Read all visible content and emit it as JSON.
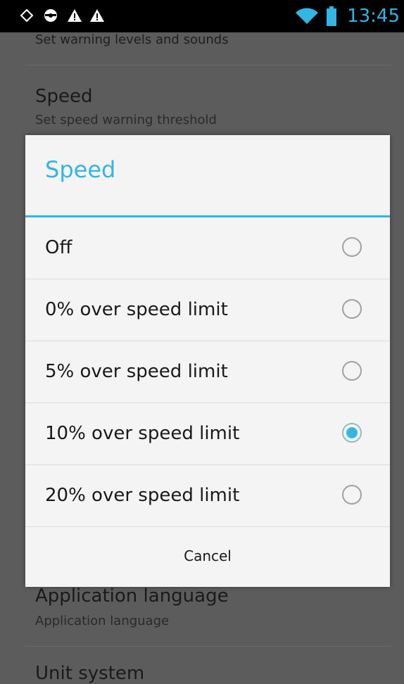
{
  "status_bar": {
    "time": "13:45",
    "icons": [
      "location-icon",
      "steering-wheel-icon",
      "warning-icon",
      "warning-icon",
      "wifi-icon",
      "battery-icon"
    ]
  },
  "settings": {
    "items": [
      {
        "summary": "Set warning levels and sounds"
      },
      {
        "title": "Speed",
        "summary": "Set speed warning threshold"
      },
      {
        "title": "Application language",
        "summary": "Application language"
      },
      {
        "title": "Unit system"
      }
    ]
  },
  "dialog": {
    "title": "Speed",
    "options": [
      {
        "label": "Off",
        "checked": false
      },
      {
        "label": "0% over speed limit",
        "checked": false
      },
      {
        "label": "5% over speed limit",
        "checked": false
      },
      {
        "label": "10% over speed limit",
        "checked": true
      },
      {
        "label": "20% over speed limit",
        "checked": false
      }
    ],
    "cancel_label": "Cancel"
  },
  "colors": {
    "accent": "#33b5e5",
    "dialog_bg": "#f4f4f4",
    "scrim": "#5c5c5c"
  }
}
